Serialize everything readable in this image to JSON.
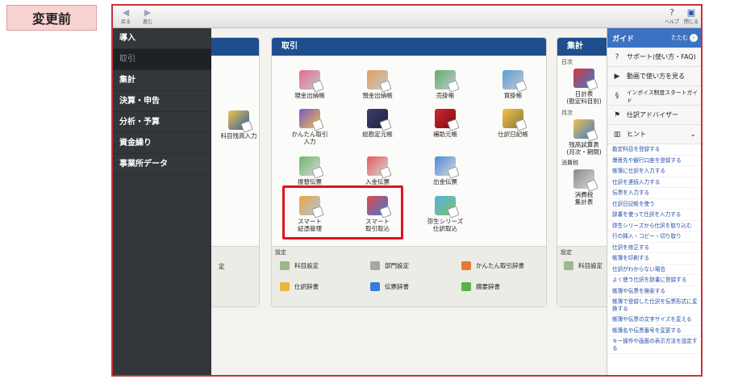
{
  "label": "変更前",
  "toolbar": {
    "back": "戻る",
    "forward": "進む",
    "help": "ヘルプ",
    "close": "閉じる"
  },
  "sidebar": {
    "items": [
      "導入",
      "取引",
      "集計",
      "決算・申告",
      "分析・予算",
      "資金繰り",
      "事業所データ"
    ]
  },
  "left_panel": {
    "tile": "科目残高入力",
    "settings_fragment": "定",
    "settings_fragment2": "定"
  },
  "center_panel": {
    "title": "取引",
    "tiles": [
      "現金出納帳",
      "預金出納帳",
      "売掛帳",
      "買掛帳",
      "かんたん取引\n入力",
      "総勘定元帳",
      "補助元帳",
      "仕訳日記帳",
      "振替伝票",
      "入金伝票",
      "出金伝票",
      "スマート\n証憑管理",
      "スマート\n取引取込",
      "弥生シリーズ\n仕訳取込"
    ],
    "settings_label": "設定",
    "settings": [
      "科目設定",
      "部門設定",
      "かんたん取引辞書",
      "仕訳辞書",
      "伝票辞書",
      "摘要辞書"
    ]
  },
  "right_panel": {
    "title": "集計",
    "sections": [
      "日次",
      "月次",
      "消費税"
    ],
    "tiles": [
      "日計表\n(勘定科目別)",
      "残高試算表\n(月次・期間)",
      "消費税\n集計表"
    ],
    "settings_label": "設定",
    "settings": [
      "科目設定"
    ]
  },
  "guide": {
    "title": "ガイド",
    "close_label": "たたむ",
    "rows": [
      {
        "icon": "?",
        "label": "サポート(使い方・FAQ)"
      },
      {
        "icon": "▶",
        "label": "動画で使い方を見る"
      },
      {
        "icon": "§",
        "label": "インボイス制度スタートガイド"
      },
      {
        "icon": "⚑",
        "label": "仕訳アドバイザー"
      }
    ],
    "hint": "ヒント",
    "links": [
      "勘定科目を登録する",
      "爆意先や銀行口座を登録する",
      "帳簿に仕訳を入力する",
      "仕訳を連続入力する",
      "伝票を入力する",
      "仕訳日記帳を使う",
      "辞書を使って仕訳を入力する",
      "弥生シリーズから仕訳を取り込む",
      "行の挿入・コピー・切り取り",
      "仕訳を修正する",
      "帳簿を印刷する",
      "仕訳がわからない場合",
      "よく使う仕訳を辞書に登録する",
      "帳簿や伝票を検索する",
      "帳簿で登録した仕訳を伝票形式に変換する",
      "帳簿や伝票の文字サイズを変える",
      "帳簿名や伝票番号を変更する",
      "キー操作や画面の表示方法を設定する"
    ]
  }
}
